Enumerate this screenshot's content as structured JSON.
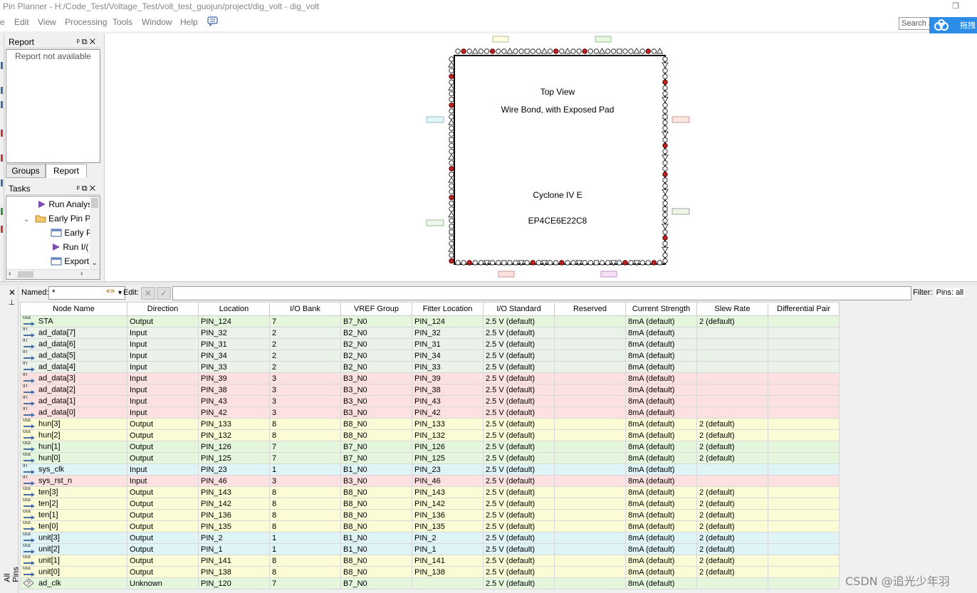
{
  "window": {
    "title": "Pin Planner - H:/Code_Test/Voltage_Test/volt_test_guojun/project/dig_volt - dig_volt"
  },
  "menu": [
    {
      "label": "e"
    },
    {
      "label": "Edit"
    },
    {
      "label": "View"
    },
    {
      "label": "Processing"
    },
    {
      "label": "Tools"
    },
    {
      "label": "Window"
    },
    {
      "label": "Help"
    }
  ],
  "search": {
    "value": "Search a"
  },
  "cloud": {
    "label": "拖拽"
  },
  "report_pane": {
    "title": "Report",
    "body": "Report not available"
  },
  "tabs": {
    "groups": "Groups",
    "report": "Report"
  },
  "tasks_pane": {
    "title": "Tasks",
    "items": [
      {
        "label": "Run Analys"
      },
      {
        "label": "Early Pin Pl"
      },
      {
        "label": "Early P"
      },
      {
        "label": "Run I/("
      },
      {
        "label": "Export"
      }
    ]
  },
  "chip": {
    "view_label": "Top View",
    "bond_label": "Wire Bond, with Exposed Pad",
    "family": "Cyclone IV E",
    "device": "EP4CE6E22C8"
  },
  "filterbar": {
    "named_label": "Named:",
    "named_value": "*",
    "edit_label": "Edit:",
    "filter_label": "Filter:",
    "filter_value": "Pins: all"
  },
  "pins_strip": {
    "label": "All Pins"
  },
  "table": {
    "columns": [
      "Node Name",
      "Direction",
      "Location",
      "I/O Bank",
      "VREF Group",
      "Fitter Location",
      "I/O Standard",
      "Reserved",
      "Current Strength",
      "Slew Rate",
      "Differential Pair"
    ],
    "rows": [
      {
        "dir": "out",
        "name": "STA",
        "direction": "Output",
        "location": "PIN_124",
        "bank": "7",
        "vref": "B7_N0",
        "fitter": "PIN_124",
        "std": "2.5 V (default)",
        "reserved": "",
        "current": "8mA (default)",
        "slew": "2 (default)",
        "diff": "",
        "color": "#e4f6dc"
      },
      {
        "dir": "in",
        "name": "ad_data[7]",
        "direction": "Input",
        "location": "PIN_32",
        "bank": "2",
        "vref": "B2_N0",
        "fitter": "PIN_32",
        "std": "2.5 V (default)",
        "reserved": "",
        "current": "8mA (default)",
        "slew": "",
        "diff": "",
        "color": "#eaf2ea"
      },
      {
        "dir": "in",
        "name": "ad_data[6]",
        "direction": "Input",
        "location": "PIN_31",
        "bank": "2",
        "vref": "B2_N0",
        "fitter": "PIN_31",
        "std": "2.5 V (default)",
        "reserved": "",
        "current": "8mA (default)",
        "slew": "",
        "diff": "",
        "color": "#eaf2ea"
      },
      {
        "dir": "in",
        "name": "ad_data[5]",
        "direction": "Input",
        "location": "PIN_34",
        "bank": "2",
        "vref": "B2_N0",
        "fitter": "PIN_34",
        "std": "2.5 V (default)",
        "reserved": "",
        "current": "8mA (default)",
        "slew": "",
        "diff": "",
        "color": "#eaf2ea"
      },
      {
        "dir": "in",
        "name": "ad_data[4]",
        "direction": "Input",
        "location": "PIN_33",
        "bank": "2",
        "vref": "B2_N0",
        "fitter": "PIN_33",
        "std": "2.5 V (default)",
        "reserved": "",
        "current": "8mA (default)",
        "slew": "",
        "diff": "",
        "color": "#eaf2ea"
      },
      {
        "dir": "in",
        "name": "ad_data[3]",
        "direction": "Input",
        "location": "PIN_39",
        "bank": "3",
        "vref": "B3_N0",
        "fitter": "PIN_39",
        "std": "2.5 V (default)",
        "reserved": "",
        "current": "8mA (default)",
        "slew": "",
        "diff": "",
        "color": "#fde0e0"
      },
      {
        "dir": "in",
        "name": "ad_data[2]",
        "direction": "Input",
        "location": "PIN_38",
        "bank": "3",
        "vref": "B3_N0",
        "fitter": "PIN_38",
        "std": "2.5 V (default)",
        "reserved": "",
        "current": "8mA (default)",
        "slew": "",
        "diff": "",
        "color": "#fde0e0"
      },
      {
        "dir": "in",
        "name": "ad_data[1]",
        "direction": "Input",
        "location": "PIN_43",
        "bank": "3",
        "vref": "B3_N0",
        "fitter": "PIN_43",
        "std": "2.5 V (default)",
        "reserved": "",
        "current": "8mA (default)",
        "slew": "",
        "diff": "",
        "color": "#fde0e0"
      },
      {
        "dir": "in",
        "name": "ad_data[0]",
        "direction": "Input",
        "location": "PIN_42",
        "bank": "3",
        "vref": "B3_N0",
        "fitter": "PIN_42",
        "std": "2.5 V (default)",
        "reserved": "",
        "current": "8mA (default)",
        "slew": "",
        "diff": "",
        "color": "#fde0e0"
      },
      {
        "dir": "out",
        "name": "hun[3]",
        "direction": "Output",
        "location": "PIN_133",
        "bank": "8",
        "vref": "B8_N0",
        "fitter": "PIN_133",
        "std": "2.5 V (default)",
        "reserved": "",
        "current": "8mA (default)",
        "slew": "2 (default)",
        "diff": "",
        "color": "#fbfbd6"
      },
      {
        "dir": "out",
        "name": "hun[2]",
        "direction": "Output",
        "location": "PIN_132",
        "bank": "8",
        "vref": "B8_N0",
        "fitter": "PIN_132",
        "std": "2.5 V (default)",
        "reserved": "",
        "current": "8mA (default)",
        "slew": "2 (default)",
        "diff": "",
        "color": "#fbfbd6"
      },
      {
        "dir": "out",
        "name": "hun[1]",
        "direction": "Output",
        "location": "PIN_126",
        "bank": "7",
        "vref": "B7_N0",
        "fitter": "PIN_126",
        "std": "2.5 V (default)",
        "reserved": "",
        "current": "8mA (default)",
        "slew": "2 (default)",
        "diff": "",
        "color": "#e4f6dc"
      },
      {
        "dir": "out",
        "name": "hun[0]",
        "direction": "Output",
        "location": "PIN_125",
        "bank": "7",
        "vref": "B7_N0",
        "fitter": "PIN_125",
        "std": "2.5 V (default)",
        "reserved": "",
        "current": "8mA (default)",
        "slew": "2 (default)",
        "diff": "",
        "color": "#e4f6dc"
      },
      {
        "dir": "in",
        "name": "sys_clk",
        "direction": "Input",
        "location": "PIN_23",
        "bank": "1",
        "vref": "B1_N0",
        "fitter": "PIN_23",
        "std": "2.5 V (default)",
        "reserved": "",
        "current": "8mA (default)",
        "slew": "",
        "diff": "",
        "color": "#def4f6"
      },
      {
        "dir": "in",
        "name": "sys_rst_n",
        "direction": "Input",
        "location": "PIN_46",
        "bank": "3",
        "vref": "B3_N0",
        "fitter": "PIN_46",
        "std": "2.5 V (default)",
        "reserved": "",
        "current": "8mA (default)",
        "slew": "",
        "diff": "",
        "color": "#fde0e0"
      },
      {
        "dir": "out",
        "name": "ten[3]",
        "direction": "Output",
        "location": "PIN_143",
        "bank": "8",
        "vref": "B8_N0",
        "fitter": "PIN_143",
        "std": "2.5 V (default)",
        "reserved": "",
        "current": "8mA (default)",
        "slew": "2 (default)",
        "diff": "",
        "color": "#fbfbd6"
      },
      {
        "dir": "out",
        "name": "ten[2]",
        "direction": "Output",
        "location": "PIN_142",
        "bank": "8",
        "vref": "B8_N0",
        "fitter": "PIN_142",
        "std": "2.5 V (default)",
        "reserved": "",
        "current": "8mA (default)",
        "slew": "2 (default)",
        "diff": "",
        "color": "#fbfbd6"
      },
      {
        "dir": "out",
        "name": "ten[1]",
        "direction": "Output",
        "location": "PIN_136",
        "bank": "8",
        "vref": "B8_N0",
        "fitter": "PIN_136",
        "std": "2.5 V (default)",
        "reserved": "",
        "current": "8mA (default)",
        "slew": "2 (default)",
        "diff": "",
        "color": "#fbfbd6"
      },
      {
        "dir": "out",
        "name": "ten[0]",
        "direction": "Output",
        "location": "PIN_135",
        "bank": "8",
        "vref": "B8_N0",
        "fitter": "PIN_135",
        "std": "2.5 V (default)",
        "reserved": "",
        "current": "8mA (default)",
        "slew": "2 (default)",
        "diff": "",
        "color": "#fbfbd6"
      },
      {
        "dir": "out",
        "name": "unit[3]",
        "direction": "Output",
        "location": "PIN_2",
        "bank": "1",
        "vref": "B1_N0",
        "fitter": "PIN_2",
        "std": "2.5 V (default)",
        "reserved": "",
        "current": "8mA (default)",
        "slew": "2 (default)",
        "diff": "",
        "color": "#def4f6"
      },
      {
        "dir": "out",
        "name": "unit[2]",
        "direction": "Output",
        "location": "PIN_1",
        "bank": "1",
        "vref": "B1_N0",
        "fitter": "PIN_1",
        "std": "2.5 V (default)",
        "reserved": "",
        "current": "8mA (default)",
        "slew": "2 (default)",
        "diff": "",
        "color": "#def4f6"
      },
      {
        "dir": "out",
        "name": "unit[1]",
        "direction": "Output",
        "location": "PIN_141",
        "bank": "8",
        "vref": "B8_N0",
        "fitter": "PIN_141",
        "std": "2.5 V (default)",
        "reserved": "",
        "current": "8mA (default)",
        "slew": "2 (default)",
        "diff": "",
        "color": "#fbfbd6"
      },
      {
        "dir": "out",
        "name": "unit[0]",
        "direction": "Output",
        "location": "PIN_138",
        "bank": "8",
        "vref": "B8_N0",
        "fitter": "PIN_138",
        "std": "2.5 V (default)",
        "reserved": "",
        "current": "8mA (default)",
        "slew": "2 (default)",
        "diff": "",
        "color": "#fbfbd6"
      },
      {
        "dir": "unk",
        "name": "ad_clk",
        "direction": "Unknown",
        "location": "PIN_120",
        "bank": "7",
        "vref": "B7_N0",
        "fitter": "",
        "std": "2.5 V (default)",
        "reserved": "",
        "current": "8mA (default)",
        "slew": "",
        "diff": "",
        "color": "#e4f6dc"
      }
    ]
  },
  "watermark": "CSDN @追光少年羽"
}
